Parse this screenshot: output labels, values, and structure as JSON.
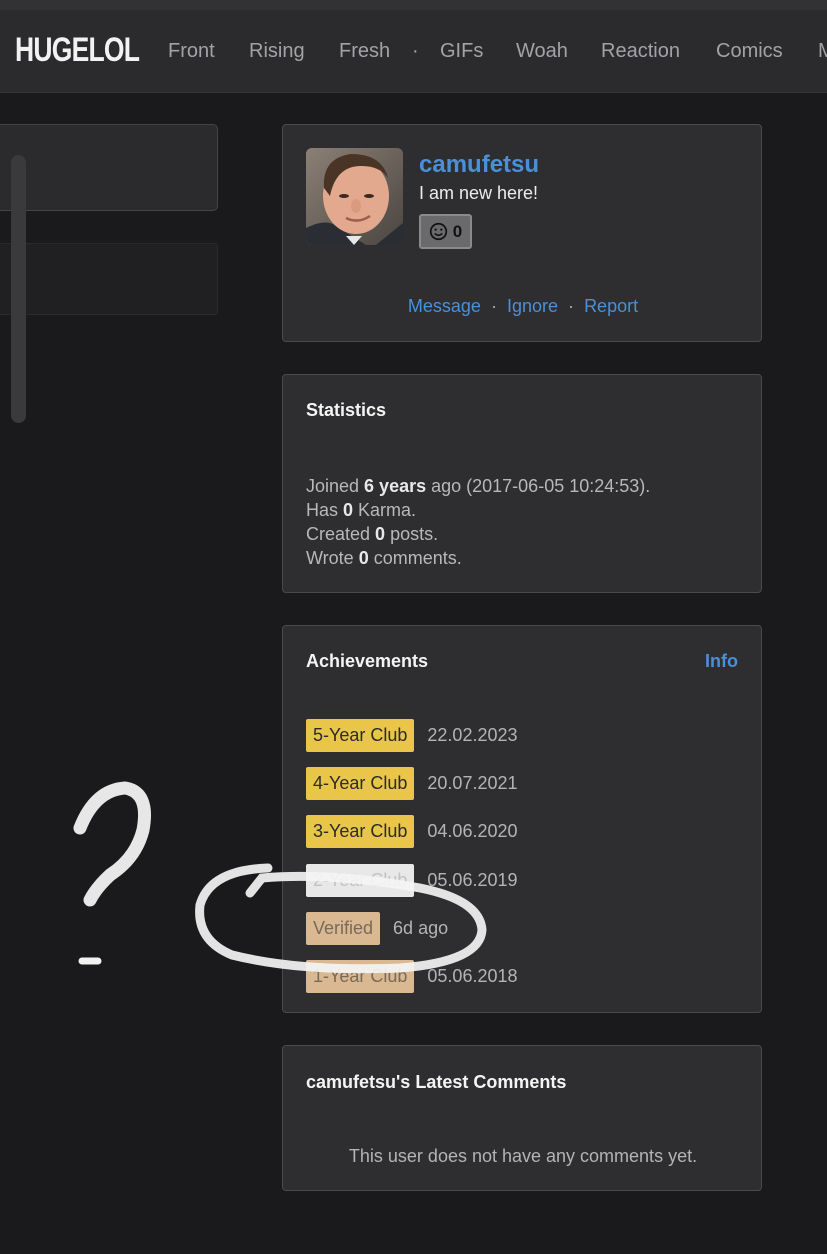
{
  "brand": {
    "logo": "HUGELOL"
  },
  "nav": [
    "Front",
    "Rising",
    "Fresh",
    "·",
    "GIFs",
    "Woah",
    "Reaction",
    "Comics",
    "M"
  ],
  "profile": {
    "username": "camufetsu",
    "status": "I am new here!",
    "karma": "0",
    "actions": {
      "message": "Message",
      "ignore": "Ignore",
      "report": "Report",
      "sep": "·"
    }
  },
  "statistics": {
    "title": "Statistics",
    "joined_prefix": "Joined ",
    "joined_bold": "6 years",
    "joined_suffix": " ago (2017-06-05 10:24:53).",
    "karma_prefix": "Has ",
    "karma_bold": "0",
    "karma_suffix": " Karma.",
    "posts_prefix": "Created ",
    "posts_bold": "0",
    "posts_suffix": " posts.",
    "comments_prefix": "Wrote ",
    "comments_bold": "0",
    "comments_suffix": " comments."
  },
  "achievements": {
    "title": "Achievements",
    "info": "Info",
    "items": [
      {
        "label": "5-Year Club",
        "date": "22.02.2023",
        "tier": "gold"
      },
      {
        "label": "4-Year Club",
        "date": "20.07.2021",
        "tier": "gold"
      },
      {
        "label": "3-Year Club",
        "date": "04.06.2020",
        "tier": "gold"
      },
      {
        "label": "2-Year Club",
        "date": "05.06.2019",
        "tier": "silver"
      },
      {
        "label": "Verified",
        "date": "6d ago",
        "tier": "bronze"
      },
      {
        "label": "1-Year Club",
        "date": "05.06.2018",
        "tier": "bronze"
      }
    ]
  },
  "latest_comments": {
    "title": "camufetsu's Latest Comments",
    "empty": "This user does not have any comments yet."
  },
  "colors": {
    "link": "#4a90d9",
    "gold": "#e9c649",
    "silver": "#e8e8e8",
    "bronze": "#d9b892",
    "background": "#1a1a1c"
  },
  "annotation": {
    "question_mark_icon": "question-mark-icon",
    "circle_icon": "hand-drawn-circle-icon"
  }
}
